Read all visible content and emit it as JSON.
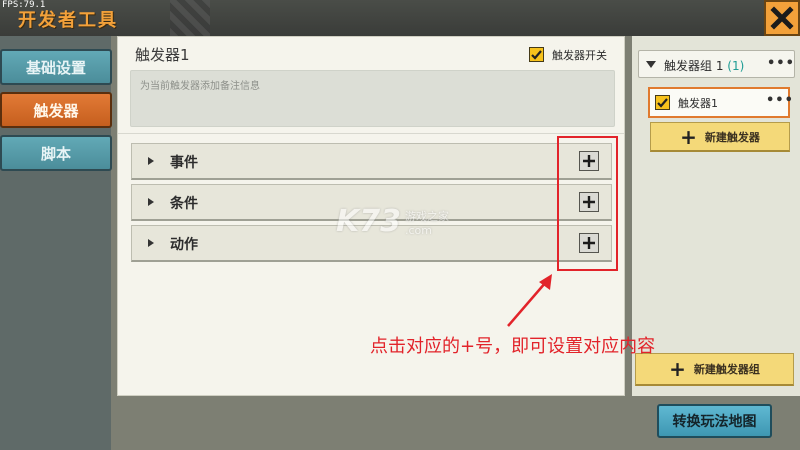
{
  "fps": "FPS:79.1",
  "app_title": "开发者工具",
  "sidebar": {
    "items": [
      {
        "label": "基础设置",
        "active": false
      },
      {
        "label": "触发器",
        "active": true
      },
      {
        "label": "脚本",
        "active": false
      }
    ]
  },
  "main": {
    "trigger_name": "触发器1",
    "switch_label": "触发器开关",
    "switch_checked": true,
    "note_placeholder": "为当前触发器添加备注信息",
    "rows": [
      {
        "label": "事件"
      },
      {
        "label": "条件"
      },
      {
        "label": "动作"
      }
    ]
  },
  "right_panel": {
    "group_name": "触发器组 1",
    "group_count": "(1)",
    "group_menu": "•••",
    "trigger_item": {
      "label": "触发器1",
      "checked": true,
      "menu": "•••"
    },
    "new_trigger_label": "新建触发器",
    "new_group_label": "新建触发器组"
  },
  "map_button_label": "转换玩法地图",
  "annotation": "点击对应的+号，即可设置对应内容",
  "watermark": {
    "main": "K73",
    "sub": "游戏之家",
    "domain": ".com"
  },
  "colors": {
    "accent_orange": "#f3a13a",
    "sidebar_active": "#e27a36",
    "sidebar_normal": "#62a9b6",
    "check_yellow": "#f7c21c",
    "annotation_red": "#e2232a",
    "count_teal": "#1f9d95"
  }
}
